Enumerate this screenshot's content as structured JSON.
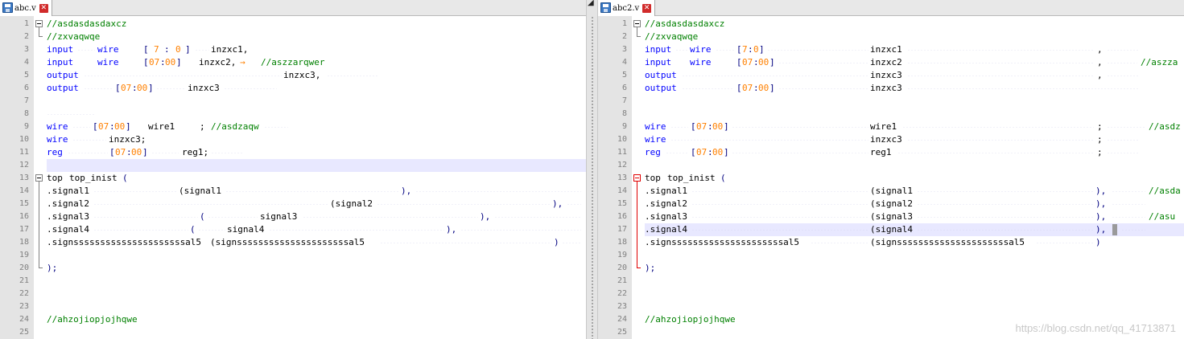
{
  "left_tab": {
    "filename": "abc.v"
  },
  "right_tab": {
    "filename": "abc2.v"
  },
  "line_numbers": [
    "1",
    "2",
    "3",
    "4",
    "5",
    "6",
    "7",
    "8",
    "9",
    "10",
    "11",
    "12",
    "13",
    "14",
    "15",
    "16",
    "17",
    "18",
    "19",
    "20",
    "21",
    "22",
    "23",
    "24",
    "25"
  ],
  "left": {
    "l1_comment": "//asdasdasdaxcz",
    "l2_comment": "//zxvaqwqe",
    "l3": {
      "kw1": "input",
      "kw2": "wire",
      "ob": "[",
      "n1": "7",
      "colon": ":",
      "n2": "0",
      "cb": "]",
      "name": "inzxc1,"
    },
    "l4": {
      "kw1": "input",
      "kw2": "wire",
      "ob": "[",
      "n1": "07",
      "colon": ":",
      "n2": "00",
      "cb": "]",
      "name": "inzxc2,",
      "arrow": "→",
      "comment": "//aszzarqwer"
    },
    "l5": {
      "kw1": "output",
      "name": "inzxc3,"
    },
    "l6": {
      "kw1": "output",
      "ob": "[",
      "n1": "07",
      "colon": ":",
      "n2": "00",
      "cb": "]",
      "name": "inzxc3"
    },
    "l9": {
      "kw1": "wire",
      "ob": "[",
      "n1": "07",
      "colon": ":",
      "n2": "00",
      "cb": "]",
      "name": "wire1",
      "semi": ";",
      "comment": "//asdzaqw"
    },
    "l10": {
      "kw1": "wire",
      "name": "inzxc3;"
    },
    "l11": {
      "kw1": "reg",
      "ob": "[",
      "n1": "07",
      "colon": ":",
      "n2": "00",
      "cb": "]",
      "name": "reg1;"
    },
    "l13": {
      "mod": "top",
      "inst": "top_inist",
      "paren": "("
    },
    "l14": {
      "port": ".signal1",
      "arg": "(signal1",
      "close": "),"
    },
    "l15": {
      "port": ".signal2",
      "arg": "(signal2",
      "close": "),"
    },
    "l16": {
      "port": ".signal3",
      "op": "(",
      "arg": "signal3",
      "close": "),"
    },
    "l17": {
      "port": ".signal4",
      "op": "(",
      "arg": "signal4",
      "close": "),"
    },
    "l18": {
      "port": ".signsssssssssssssssssssssal5",
      "arg": "(signsssssssssssssssssssssal5",
      "close": ")"
    },
    "l20": {
      "close": ");"
    },
    "l24_comment": "//ahzojiopjojhqwe"
  },
  "right": {
    "l1_comment": "//asdasdasdaxcz",
    "l2_comment": "//zxvaqwqe",
    "l3": {
      "kw1": "input",
      "kw2": "wire",
      "ob": "[",
      "n1": "7",
      "colon": ":",
      "n2": "0",
      "cb": "]",
      "name": "inzxc1",
      "comma": ","
    },
    "l4": {
      "kw1": "input",
      "kw2": "wire",
      "ob": "[",
      "n1": "07",
      "colon": ":",
      "n2": "00",
      "cb": "]",
      "name": "inzxc2",
      "comma": ",",
      "comment": "//aszza"
    },
    "l5": {
      "kw1": "output",
      "name": "inzxc3",
      "comma": ","
    },
    "l6": {
      "kw1": "output",
      "ob": "[",
      "n1": "07",
      "colon": ":",
      "n2": "00",
      "cb": "]",
      "name": "inzxc3"
    },
    "l9": {
      "kw1": "wire",
      "ob": "[",
      "n1": "07",
      "colon": ":",
      "n2": "00",
      "cb": "]",
      "name": "wire1",
      "semi": ";",
      "comment": "//asdz"
    },
    "l10": {
      "kw1": "wire",
      "name": "inzxc3",
      "semi": ";"
    },
    "l11": {
      "kw1": "reg",
      "ob": "[",
      "n1": "07",
      "colon": ":",
      "n2": "00",
      "cb": "]",
      "name": "reg1",
      "semi": ";"
    },
    "l13": {
      "mod": "top",
      "inst": "top_inist",
      "paren": "("
    },
    "l14": {
      "port": ".signal1",
      "arg": "(signal1",
      "close": "),",
      "comment": "//asda"
    },
    "l15": {
      "port": ".signal2",
      "arg": "(signal2",
      "close": "),"
    },
    "l16": {
      "port": ".signal3",
      "arg": "(signal3",
      "close": "),",
      "comment": "//asu"
    },
    "l17": {
      "port": ".signal4",
      "arg": "(signal4",
      "close": "),"
    },
    "l18": {
      "port": ".signsssssssssssssssssssssal5",
      "arg": "(signsssssssssssssssssssssal5",
      "close": ")"
    },
    "l20": {
      "close": ");"
    },
    "l24_comment": "//ahzojiopjojhqwe"
  },
  "watermark": "https://blog.csdn.net/qq_41713871",
  "colors": {
    "keyword": "#0000ff",
    "comment": "#008000",
    "number": "#ff8000",
    "line_highlight": "#e8e8ff",
    "fold_active": "#e00000"
  }
}
